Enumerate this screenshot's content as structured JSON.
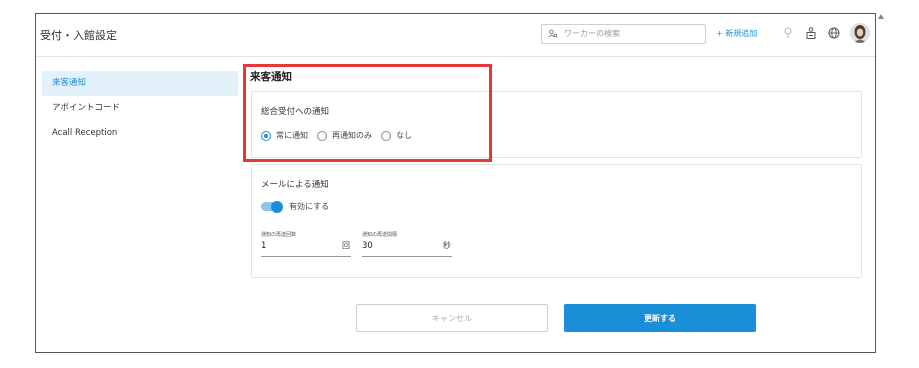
{
  "header": {
    "title": "受付・入館設定",
    "search_placeholder": "ワーカーの検索",
    "add_new_label": "+ 新規追加"
  },
  "sidebar": {
    "items": [
      {
        "label": "来客通知",
        "active": true
      },
      {
        "label": "アポイントコード",
        "active": false
      },
      {
        "label": "Acall Reception",
        "active": false
      }
    ]
  },
  "main": {
    "section_title": "来客通知",
    "reception_notification": {
      "title": "総合受付への通知",
      "options": [
        {
          "label": "常に通知",
          "selected": true
        },
        {
          "label": "再通知のみ",
          "selected": false
        },
        {
          "label": "なし",
          "selected": false
        }
      ]
    },
    "email_notification": {
      "title": "メールによる通知",
      "toggle_label": "有効にする",
      "toggle_on": true,
      "renotify_count": {
        "label": "通知の再送回数",
        "value": "1",
        "unit": "回"
      },
      "renotify_interval": {
        "label": "通知の再送間隔",
        "value": "30",
        "unit": "秒"
      }
    },
    "buttons": {
      "cancel": "キャンセル",
      "update": "更新する"
    }
  },
  "colors": {
    "accent": "#1a8fd8",
    "highlight": "#e53935",
    "sidebar_active_bg": "#e3f1fb"
  }
}
